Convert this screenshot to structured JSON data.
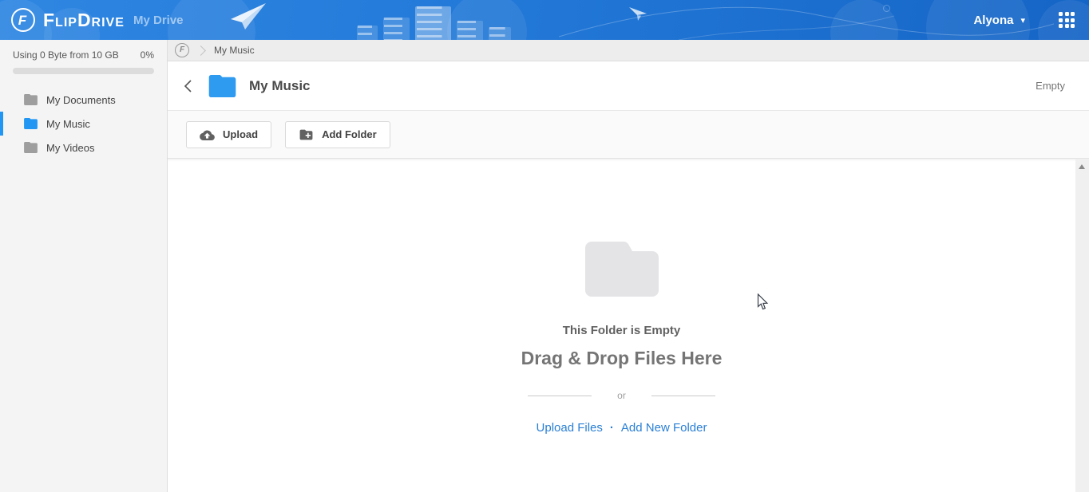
{
  "header": {
    "brand": "FlipDrive",
    "logo_letter": "F",
    "nav": {
      "my_drive": "My Drive"
    },
    "user": {
      "name": "Alyona",
      "caret": "▾"
    }
  },
  "sidebar": {
    "usage": {
      "text": "Using 0 Byte from 10 GB",
      "percent": "0%"
    },
    "items": [
      {
        "label": "My Documents"
      },
      {
        "label": "My Music"
      },
      {
        "label": "My Videos"
      }
    ],
    "selected_index": 1
  },
  "breadcrumb": {
    "home_letter": "F",
    "current": "My Music"
  },
  "main": {
    "title": "My Music",
    "status": "Empty",
    "toolbar": {
      "upload": "Upload",
      "add_folder": "Add Folder"
    },
    "empty": {
      "heading": "This Folder is Empty",
      "subheading": "Drag & Drop Files Here",
      "or": "or",
      "upload_link": "Upload Files",
      "separator": "·",
      "add_folder_link": "Add New Folder"
    }
  },
  "colors": {
    "header_gradient_start": "#2f87e2",
    "header_gradient_end": "#1565c6",
    "accent_blue": "#2196f3",
    "link_blue": "#2a7fd4",
    "sidebar_bg": "#f4f4f4",
    "empty_folder_gray": "#e4e4e7"
  }
}
